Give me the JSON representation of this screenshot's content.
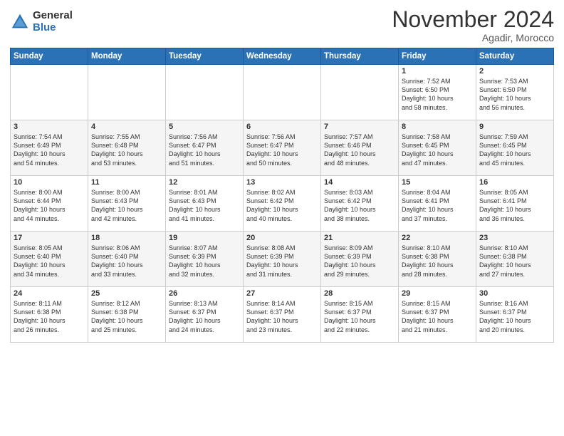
{
  "header": {
    "logo_general": "General",
    "logo_blue": "Blue",
    "month_title": "November 2024",
    "location": "Agadir, Morocco"
  },
  "days_of_week": [
    "Sunday",
    "Monday",
    "Tuesday",
    "Wednesday",
    "Thursday",
    "Friday",
    "Saturday"
  ],
  "weeks": [
    {
      "cells": [
        {
          "day": "",
          "info": ""
        },
        {
          "day": "",
          "info": ""
        },
        {
          "day": "",
          "info": ""
        },
        {
          "day": "",
          "info": ""
        },
        {
          "day": "",
          "info": ""
        },
        {
          "day": "1",
          "info": "Sunrise: 7:52 AM\nSunset: 6:50 PM\nDaylight: 10 hours\nand 58 minutes."
        },
        {
          "day": "2",
          "info": "Sunrise: 7:53 AM\nSunset: 6:50 PM\nDaylight: 10 hours\nand 56 minutes."
        }
      ]
    },
    {
      "cells": [
        {
          "day": "3",
          "info": "Sunrise: 7:54 AM\nSunset: 6:49 PM\nDaylight: 10 hours\nand 54 minutes."
        },
        {
          "day": "4",
          "info": "Sunrise: 7:55 AM\nSunset: 6:48 PM\nDaylight: 10 hours\nand 53 minutes."
        },
        {
          "day": "5",
          "info": "Sunrise: 7:56 AM\nSunset: 6:47 PM\nDaylight: 10 hours\nand 51 minutes."
        },
        {
          "day": "6",
          "info": "Sunrise: 7:56 AM\nSunset: 6:47 PM\nDaylight: 10 hours\nand 50 minutes."
        },
        {
          "day": "7",
          "info": "Sunrise: 7:57 AM\nSunset: 6:46 PM\nDaylight: 10 hours\nand 48 minutes."
        },
        {
          "day": "8",
          "info": "Sunrise: 7:58 AM\nSunset: 6:45 PM\nDaylight: 10 hours\nand 47 minutes."
        },
        {
          "day": "9",
          "info": "Sunrise: 7:59 AM\nSunset: 6:45 PM\nDaylight: 10 hours\nand 45 minutes."
        }
      ]
    },
    {
      "cells": [
        {
          "day": "10",
          "info": "Sunrise: 8:00 AM\nSunset: 6:44 PM\nDaylight: 10 hours\nand 44 minutes."
        },
        {
          "day": "11",
          "info": "Sunrise: 8:00 AM\nSunset: 6:43 PM\nDaylight: 10 hours\nand 42 minutes."
        },
        {
          "day": "12",
          "info": "Sunrise: 8:01 AM\nSunset: 6:43 PM\nDaylight: 10 hours\nand 41 minutes."
        },
        {
          "day": "13",
          "info": "Sunrise: 8:02 AM\nSunset: 6:42 PM\nDaylight: 10 hours\nand 40 minutes."
        },
        {
          "day": "14",
          "info": "Sunrise: 8:03 AM\nSunset: 6:42 PM\nDaylight: 10 hours\nand 38 minutes."
        },
        {
          "day": "15",
          "info": "Sunrise: 8:04 AM\nSunset: 6:41 PM\nDaylight: 10 hours\nand 37 minutes."
        },
        {
          "day": "16",
          "info": "Sunrise: 8:05 AM\nSunset: 6:41 PM\nDaylight: 10 hours\nand 36 minutes."
        }
      ]
    },
    {
      "cells": [
        {
          "day": "17",
          "info": "Sunrise: 8:05 AM\nSunset: 6:40 PM\nDaylight: 10 hours\nand 34 minutes."
        },
        {
          "day": "18",
          "info": "Sunrise: 8:06 AM\nSunset: 6:40 PM\nDaylight: 10 hours\nand 33 minutes."
        },
        {
          "day": "19",
          "info": "Sunrise: 8:07 AM\nSunset: 6:39 PM\nDaylight: 10 hours\nand 32 minutes."
        },
        {
          "day": "20",
          "info": "Sunrise: 8:08 AM\nSunset: 6:39 PM\nDaylight: 10 hours\nand 31 minutes."
        },
        {
          "day": "21",
          "info": "Sunrise: 8:09 AM\nSunset: 6:39 PM\nDaylight: 10 hours\nand 29 minutes."
        },
        {
          "day": "22",
          "info": "Sunrise: 8:10 AM\nSunset: 6:38 PM\nDaylight: 10 hours\nand 28 minutes."
        },
        {
          "day": "23",
          "info": "Sunrise: 8:10 AM\nSunset: 6:38 PM\nDaylight: 10 hours\nand 27 minutes."
        }
      ]
    },
    {
      "cells": [
        {
          "day": "24",
          "info": "Sunrise: 8:11 AM\nSunset: 6:38 PM\nDaylight: 10 hours\nand 26 minutes."
        },
        {
          "day": "25",
          "info": "Sunrise: 8:12 AM\nSunset: 6:38 PM\nDaylight: 10 hours\nand 25 minutes."
        },
        {
          "day": "26",
          "info": "Sunrise: 8:13 AM\nSunset: 6:37 PM\nDaylight: 10 hours\nand 24 minutes."
        },
        {
          "day": "27",
          "info": "Sunrise: 8:14 AM\nSunset: 6:37 PM\nDaylight: 10 hours\nand 23 minutes."
        },
        {
          "day": "28",
          "info": "Sunrise: 8:15 AM\nSunset: 6:37 PM\nDaylight: 10 hours\nand 22 minutes."
        },
        {
          "day": "29",
          "info": "Sunrise: 8:15 AM\nSunset: 6:37 PM\nDaylight: 10 hours\nand 21 minutes."
        },
        {
          "day": "30",
          "info": "Sunrise: 8:16 AM\nSunset: 6:37 PM\nDaylight: 10 hours\nand 20 minutes."
        }
      ]
    }
  ]
}
